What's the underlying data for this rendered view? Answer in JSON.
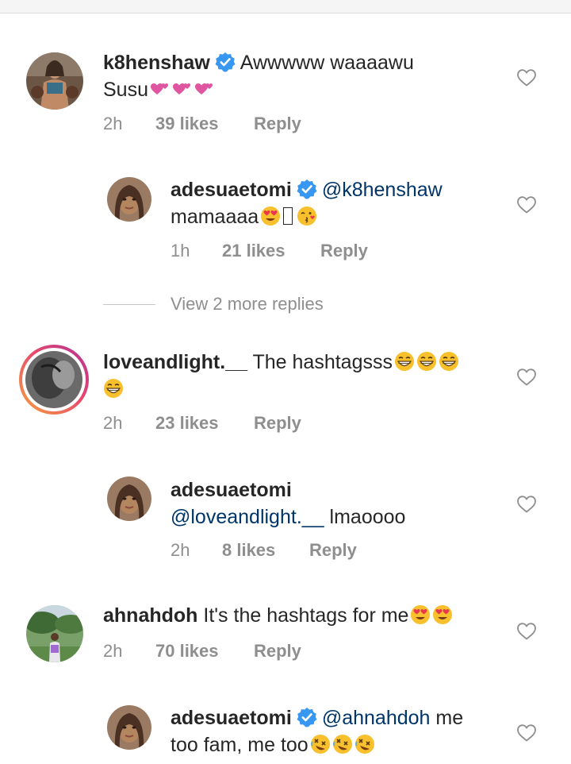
{
  "comments": [
    {
      "username": "k8henshaw",
      "verified": true,
      "text_a": "Awwwww waaaawu",
      "text_b": "Susu",
      "time": "2h",
      "likes": "39 likes",
      "reply": "Reply"
    },
    {
      "username": "adesuaetomi",
      "verified": true,
      "mention": "@k8henshaw",
      "text_b": "mamaaaa",
      "time": "1h",
      "likes": "21 likes",
      "reply": "Reply"
    },
    {
      "username": "loveandlight.__",
      "verified": false,
      "text_a": "The hashtagsss",
      "time": "2h",
      "likes": "23 likes",
      "reply": "Reply"
    },
    {
      "username": "adesuaetomi",
      "verified": false,
      "mention": "@loveandlight.__",
      "text_b": "lmaoooo",
      "time": "2h",
      "likes": "8 likes",
      "reply": "Reply"
    },
    {
      "username": "ahnahdoh",
      "verified": false,
      "text_a": "It's the hashtags for me",
      "time": "2h",
      "likes": "70 likes",
      "reply": "Reply"
    },
    {
      "username": "adesuaetomi",
      "verified": true,
      "mention": "@ahnahdoh",
      "text_a": "me",
      "text_b": "too fam, me too"
    }
  ],
  "view_more_replies": "View 2 more replies",
  "colors": {
    "meta": "#8e8e8e",
    "mention": "#003569",
    "verified": "#3897f0"
  },
  "icons": [
    "heart-outline-icon",
    "verified-badge-icon"
  ]
}
